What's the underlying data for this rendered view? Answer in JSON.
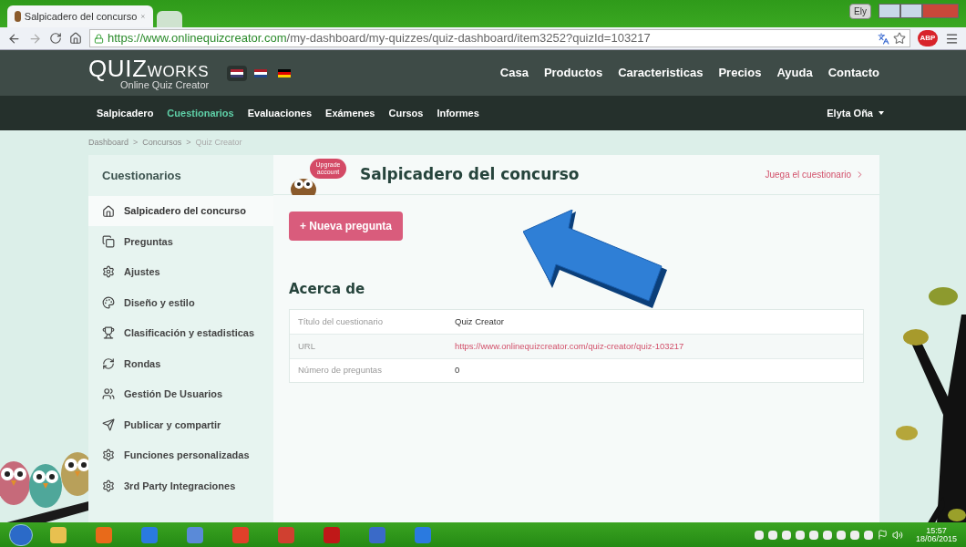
{
  "browser": {
    "tab_title": "Salpicadero del concurso",
    "profile": "Ely",
    "url_secure": "https://www.onlinequizcreator.com",
    "url_path": "/my-dashboard/my-quizzes/quiz-dashboard/item3252?quizId=103217",
    "adblock": "ABP"
  },
  "site": {
    "logo_main": "QUIZ",
    "logo_sub": "WORKS",
    "tagline": "Online Quiz Creator",
    "flags": [
      {
        "selected": true
      },
      {
        "selected": false
      },
      {
        "selected": false
      }
    ],
    "top_nav": [
      "Casa",
      "Productos",
      "Caracteristicas",
      "Precios",
      "Ayuda",
      "Contacto"
    ],
    "sub_nav": [
      {
        "label": "Salpicadero",
        "selected": false
      },
      {
        "label": "Cuestionarios",
        "selected": true
      },
      {
        "label": "Evaluaciones",
        "selected": false
      },
      {
        "label": "Exámenes",
        "selected": false
      },
      {
        "label": "Cursos",
        "selected": false
      },
      {
        "label": "Informes",
        "selected": false
      }
    ],
    "user": "Elyta Oña"
  },
  "breadcrumb": [
    {
      "label": "Dashboard",
      "kind": "link"
    },
    {
      "label": ">",
      "kind": "sep"
    },
    {
      "label": "Concursos",
      "kind": "link"
    },
    {
      "label": ">",
      "kind": "sep"
    },
    {
      "label": "Quiz Creator",
      "kind": "current"
    }
  ],
  "sidebar": {
    "title": "Cuestionarios",
    "items": [
      {
        "label": "Salpicadero del concurso",
        "selected": true
      },
      {
        "label": "Preguntas",
        "selected": false
      },
      {
        "label": "Ajustes",
        "selected": false
      },
      {
        "label": "Diseño y estilo",
        "selected": false
      },
      {
        "label": "Clasificación y estadisticas",
        "selected": false
      },
      {
        "label": "Rondas",
        "selected": false
      },
      {
        "label": "Gestión De Usuarios",
        "selected": false
      },
      {
        "label": "Publicar y compartir",
        "selected": false
      },
      {
        "label": "Funciones personalizadas",
        "selected": false
      },
      {
        "label": "3rd Party Integraciones",
        "selected": false
      }
    ]
  },
  "main": {
    "upgrade_badge": "Upgrade account",
    "title": "Salpicadero del concurso",
    "play_link": "Juega el cuestionario",
    "new_button": "+ Nueva pregunta",
    "section_title": "Acerca de",
    "about_rows": [
      {
        "label": "Título del cuestionario",
        "value": "Quiz Creator",
        "kind": "text"
      },
      {
        "label": "URL",
        "value": "https://www.onlinequizcreator.com/quiz-creator/quiz-103217",
        "kind": "link"
      },
      {
        "label": "Número de preguntas",
        "value": "0",
        "kind": "text"
      }
    ]
  },
  "taskbar": {
    "time": "15:57",
    "date": "18/06/2015"
  }
}
